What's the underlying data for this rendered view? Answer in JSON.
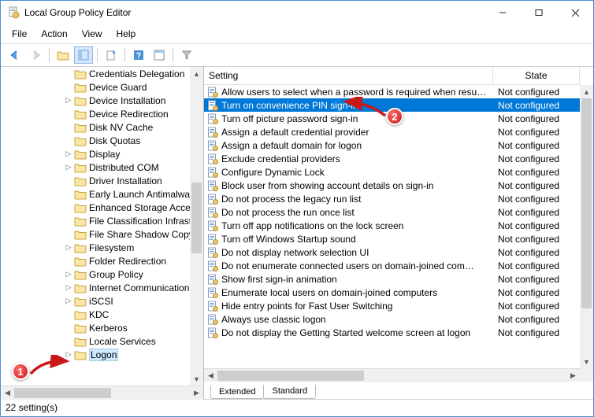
{
  "window": {
    "title": "Local Group Policy Editor"
  },
  "menu": {
    "file": "File",
    "action": "Action",
    "view": "View",
    "help": "Help"
  },
  "columns": {
    "setting": "Setting",
    "state": "State"
  },
  "tabs": {
    "extended": "Extended",
    "standard": "Standard"
  },
  "status": "22 setting(s)",
  "tree": [
    {
      "label": "Credentials Delegation"
    },
    {
      "label": "Device Guard"
    },
    {
      "label": "Device Installation"
    },
    {
      "label": "Device Redirection"
    },
    {
      "label": "Disk NV Cache"
    },
    {
      "label": "Disk Quotas"
    },
    {
      "label": "Display"
    },
    {
      "label": "Distributed COM"
    },
    {
      "label": "Driver Installation"
    },
    {
      "label": "Early Launch Antimalware"
    },
    {
      "label": "Enhanced Storage Access"
    },
    {
      "label": "File Classification Infrastruc"
    },
    {
      "label": "File Share Shadow Copy Pr"
    },
    {
      "label": "Filesystem"
    },
    {
      "label": "Folder Redirection"
    },
    {
      "label": "Group Policy"
    },
    {
      "label": "Internet Communication M"
    },
    {
      "label": "iSCSI"
    },
    {
      "label": "KDC"
    },
    {
      "label": "Kerberos"
    },
    {
      "label": "Locale Services"
    },
    {
      "label": "Logon",
      "selected": true
    }
  ],
  "settings": [
    {
      "label": "Allow users to select when a password is required when resu…",
      "state": "Not configured"
    },
    {
      "label": "Turn on convenience PIN sign-in",
      "state": "Not configured",
      "selected": true
    },
    {
      "label": "Turn off picture password sign-in",
      "state": "Not configured"
    },
    {
      "label": "Assign a default credential provider",
      "state": "Not configured"
    },
    {
      "label": "Assign a default domain for logon",
      "state": "Not configured"
    },
    {
      "label": "Exclude credential providers",
      "state": "Not configured"
    },
    {
      "label": "Configure Dynamic Lock",
      "state": "Not configured"
    },
    {
      "label": "Block user from showing account details on sign-in",
      "state": "Not configured"
    },
    {
      "label": "Do not process the legacy run list",
      "state": "Not configured"
    },
    {
      "label": "Do not process the run once list",
      "state": "Not configured"
    },
    {
      "label": "Turn off app notifications on the lock screen",
      "state": "Not configured"
    },
    {
      "label": "Turn off Windows Startup sound",
      "state": "Not configured"
    },
    {
      "label": "Do not display network selection UI",
      "state": "Not configured"
    },
    {
      "label": "Do not enumerate connected users on domain-joined com…",
      "state": "Not configured"
    },
    {
      "label": "Show first sign-in animation",
      "state": "Not configured"
    },
    {
      "label": "Enumerate local users on domain-joined computers",
      "state": "Not configured"
    },
    {
      "label": "Hide entry points for Fast User Switching",
      "state": "Not configured"
    },
    {
      "label": "Always use classic logon",
      "state": "Not configured"
    },
    {
      "label": "Do not display the Getting Started welcome screen at logon",
      "state": "Not configured"
    }
  ],
  "annotations": {
    "badge1": "1",
    "badge2": "2"
  }
}
